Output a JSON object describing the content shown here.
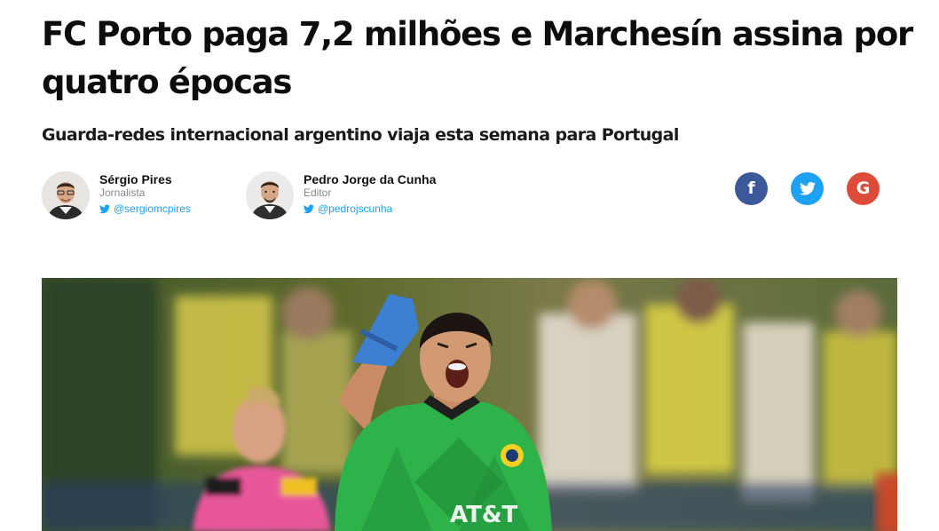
{
  "article": {
    "headline": "FC Porto paga 7,2 milhões e Marchesín assina por quatro épocas",
    "subtitle": "Guarda-redes internacional argentino viaja esta semana para Portugal"
  },
  "authors": [
    {
      "name": "Sérgio Pires",
      "role": "Jornalista",
      "twitter": "@sergiomcpires"
    },
    {
      "name": "Pedro Jorge da Cunha",
      "role": "Editor",
      "twitter": "@pedrojscunha"
    }
  ],
  "share": [
    {
      "network": "facebook",
      "icon": "facebook-icon",
      "glyph": "f",
      "color": "#3b5998"
    },
    {
      "network": "twitter",
      "icon": "twitter-icon",
      "color": "#1da1f2"
    },
    {
      "network": "google",
      "icon": "google-icon",
      "glyph": "G",
      "color": "#dd4b39"
    }
  ],
  "photo": {
    "icon": "goalkeeper-celebrating-photo"
  }
}
